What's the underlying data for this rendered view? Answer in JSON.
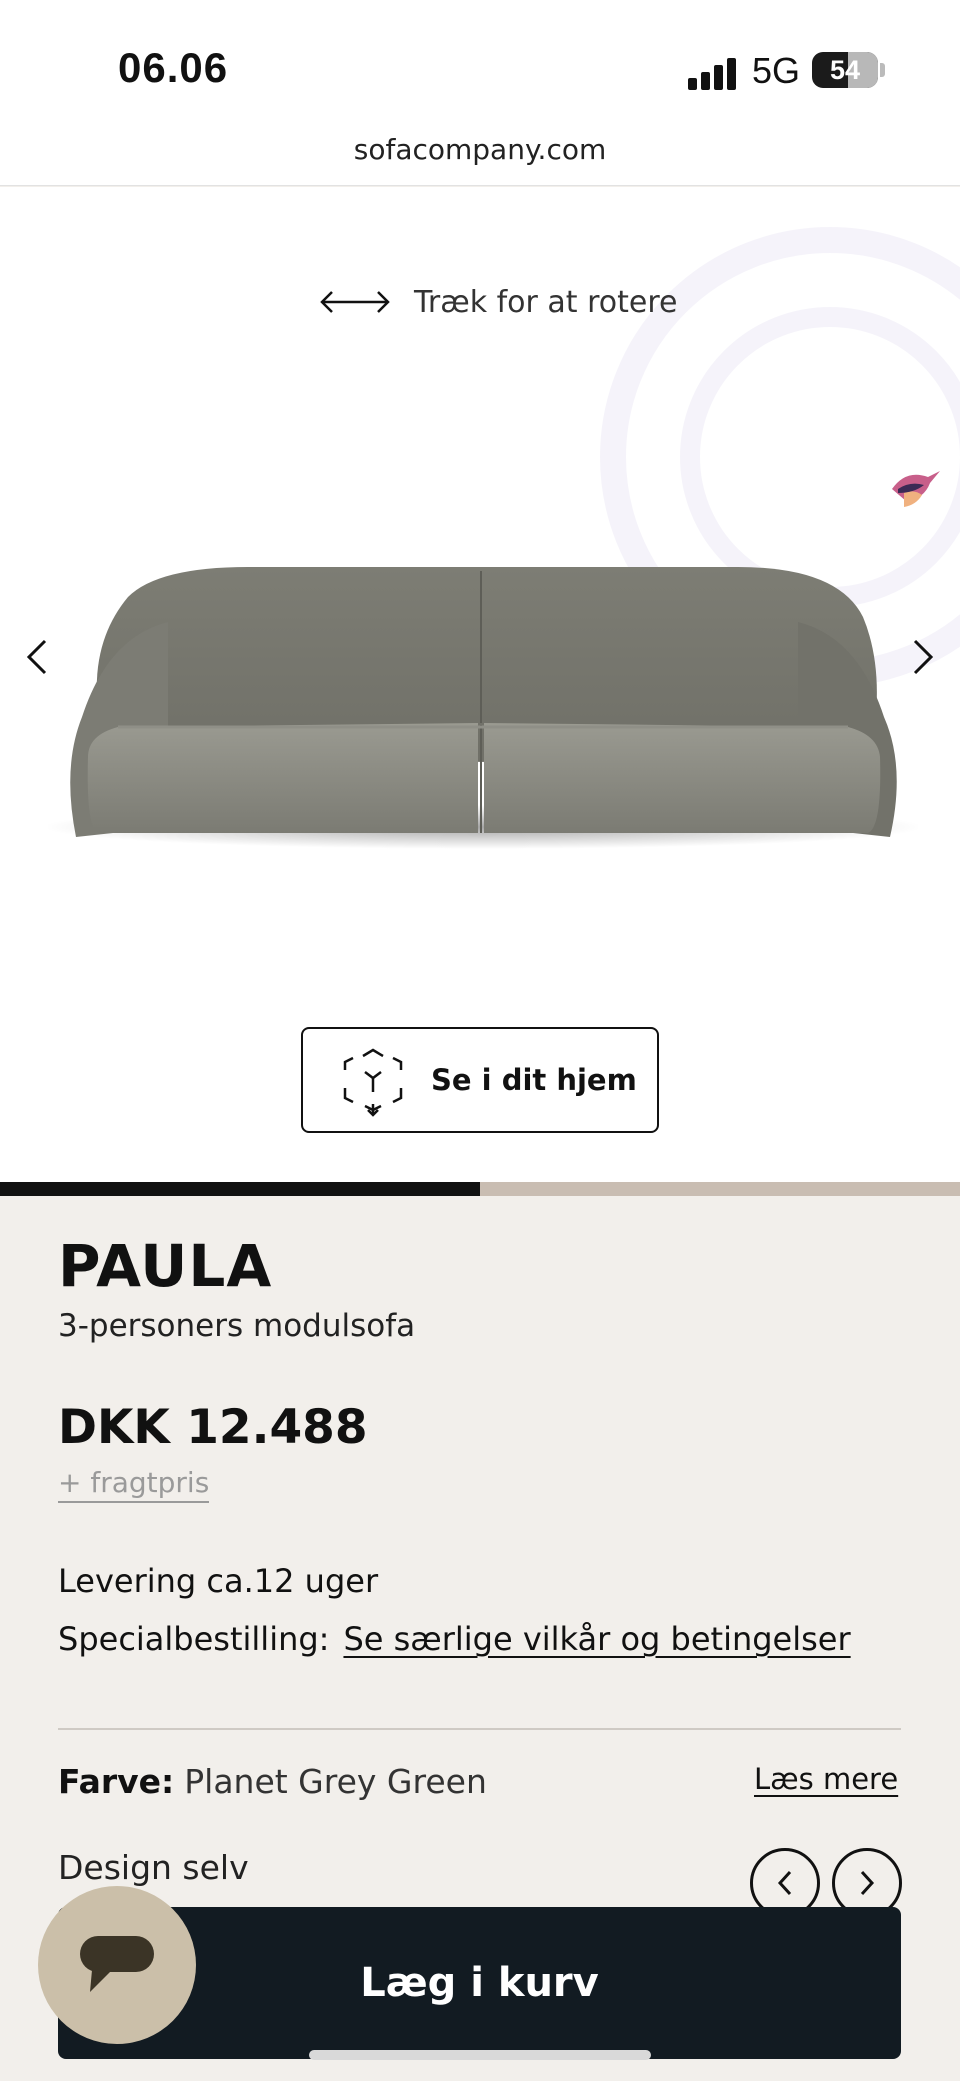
{
  "status_bar": {
    "time": "06.06",
    "network": "5G",
    "battery": "54"
  },
  "browser": {
    "url": "sofacompany.com"
  },
  "viewer": {
    "rotate_hint": "Træk for at rotere",
    "ar_button_label": "Se i dit hjem",
    "gallery_progress": 0.5,
    "icons": [
      "arrow-left-right-icon",
      "chevron-left-icon",
      "chevron-right-icon",
      "ar-cube-icon",
      "bird-logo-icon"
    ]
  },
  "product": {
    "name": "PAULA",
    "subtitle": "3-personers modulsofa",
    "price": "DKK 12.488",
    "shipping_link": "+ fragtpris",
    "delivery": "Levering ca.12 uger",
    "special_order_label": "Specialbestilling:",
    "special_order_link": "Se særlige vilkår og betingelser",
    "color_label": "Farve:",
    "color_value": "Planet Grey Green",
    "read_more": "Læs mere",
    "design_self": "Design selv"
  },
  "actions": {
    "add_to_cart": "Læg i kurv"
  },
  "colors": {
    "cart_button": "#121b22",
    "background": "#f2efeb",
    "chat_bubble": "#cbbfa9",
    "progress_track": "#c9bdb2",
    "sofa": "#85857c"
  }
}
